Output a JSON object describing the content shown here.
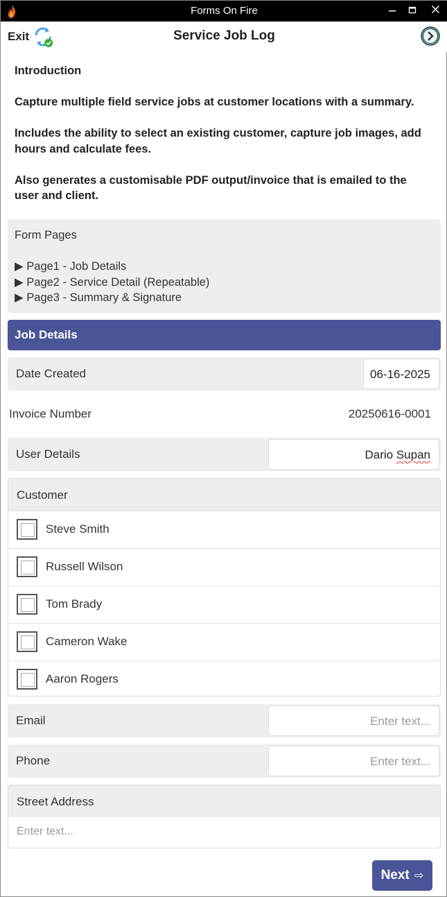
{
  "window": {
    "title": "Forms On Fire",
    "minimize": "▬",
    "maximize": "▭",
    "close": "✕"
  },
  "header": {
    "exit_label": "Exit",
    "page_title": "Service Job Log"
  },
  "intro": {
    "heading": "Introduction",
    "paragraphs": [
      "Capture multiple field service jobs at customer locations with a summary.",
      "Includes the ability to select an existing customer, capture job images, add hours and calculate fees.",
      "Also generates a customisable PDF output/invoice that is emailed to the user and client."
    ]
  },
  "form_pages": {
    "title": "Form Pages",
    "items": [
      "▶ Page1 - Job Details",
      "▶ Page2 - Service Detail (Repeatable)",
      "▶ Page3 - Summary & Signature"
    ]
  },
  "section": {
    "title": "Job Details"
  },
  "fields": {
    "date_created": {
      "label": "Date Created",
      "value": "06-16-2025"
    },
    "invoice_number": {
      "label": "Invoice Number",
      "value": "20250616-0001"
    },
    "user_details": {
      "label": "User Details",
      "value_first": "Dario ",
      "value_last": "Supan"
    },
    "customer": {
      "label": "Customer",
      "options": [
        "Steve Smith",
        "Russell Wilson",
        "Tom Brady",
        "Cameron Wake",
        "Aaron Rogers"
      ]
    },
    "email": {
      "label": "Email",
      "placeholder": "Enter text..."
    },
    "phone": {
      "label": "Phone",
      "placeholder": "Enter text..."
    },
    "street_address": {
      "label": "Street Address",
      "placeholder": "Enter text..."
    }
  },
  "footer": {
    "next_label": "Next",
    "next_arrow": "⇨"
  },
  "colors": {
    "accent": "#4a5598",
    "panel": "#eeeeee",
    "titlebar": "#000000"
  }
}
